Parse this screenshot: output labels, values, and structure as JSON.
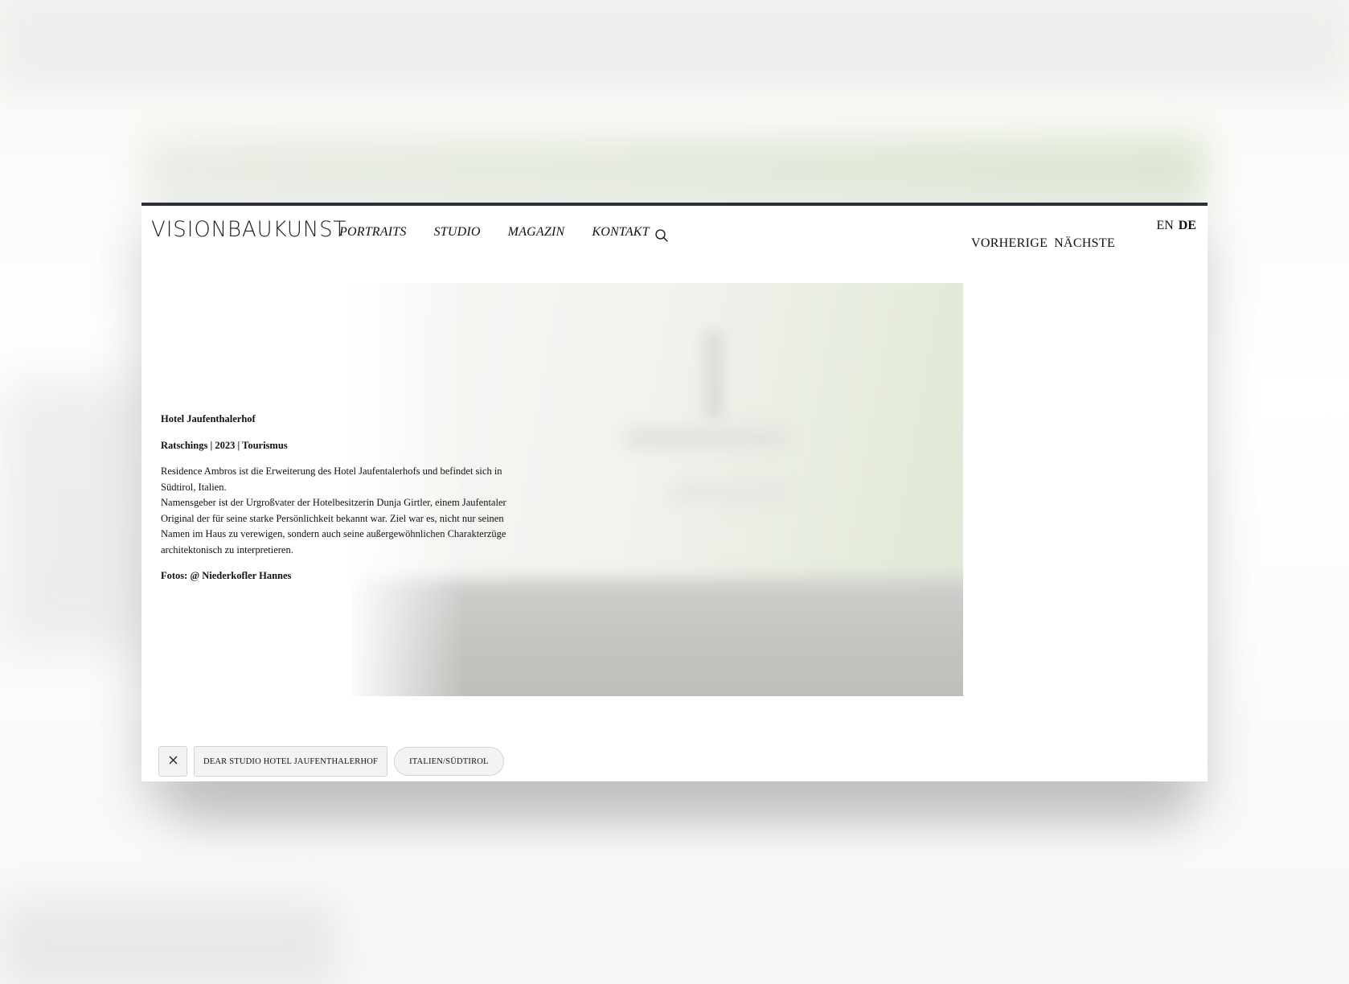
{
  "header": {
    "logo": "VISIONBAUKUNST",
    "nav": [
      "PORTRAITS",
      "STUDIO",
      "MAGAZIN",
      "KONTAKT"
    ],
    "search_icon": "search-icon",
    "pager": {
      "prev": "VORHERIGE",
      "next": "NÄCHSTE"
    },
    "lang": {
      "en": "EN",
      "de": "DE",
      "active": "DE"
    }
  },
  "project": {
    "title": "Hotel Jaufenthalerhof",
    "meta": "Ratschings | 2023 | Tourismus",
    "description": [
      "Residence Ambros ist die Erweiterung des Hotel Jaufentalerhofs und befindet sich in Südtirol, Italien.",
      "Namensgeber ist der Urgroßvater der Hotelbesitzerin Dunja Girtler, einem Jaufentaler Original der für seine starke Persönlichkeit bekannt war. Ziel war es, nicht nur seinen Namen im Haus zu verewigen, sondern auch seine außergewöhnlichen Charakterzüge architektonisch zu interpretieren."
    ],
    "credit": "Fotos: @ Niederkofler Hannes"
  },
  "tags": {
    "close_icon": "close-icon",
    "items": [
      "DEAR STUDIO HOTEL JAUFENTHALERHOF",
      "ITALIEN/SÜDTIROL"
    ]
  },
  "colors": {
    "modal_border": "#2b2f36",
    "tag_bg": "#f3f3f3",
    "tag_border": "#d4d4d4"
  }
}
